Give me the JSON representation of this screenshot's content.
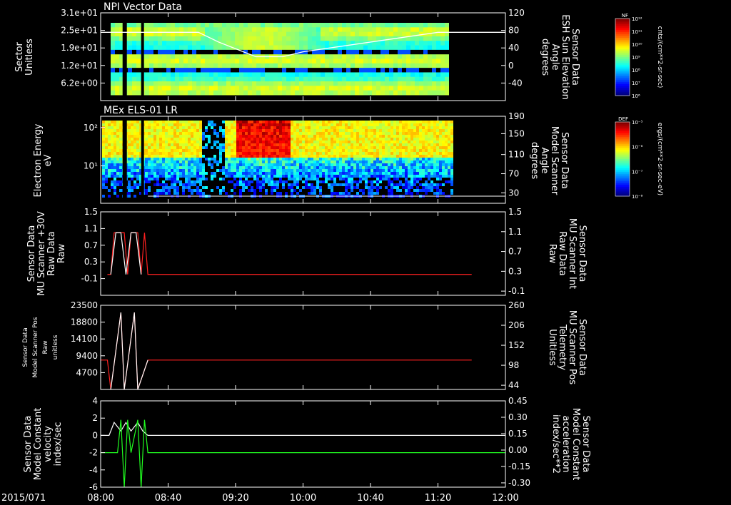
{
  "colors": {
    "background": "#000000",
    "axis": "#ffffff",
    "red": "#ff2020",
    "green": "#20ff20"
  },
  "time_axis": {
    "date": "2015/071",
    "ticks": [
      "08:00",
      "08:40",
      "09:20",
      "10:00",
      "10:40",
      "11:20",
      "12:00"
    ]
  },
  "chart_data": [
    {
      "type": "heatmap",
      "title": "NPI Vector Data",
      "ylabel": "Sector\nUnitless",
      "y_ticks": [
        "3.1e+01",
        "2.5e+01",
        "1.9e+01",
        "1.2e+01",
        "6.2e+00"
      ],
      "y2label": "Sensor Data\nESH Sun Elevation\nAngle\ndegrees",
      "y2_ticks": [
        "120",
        "80",
        "40",
        "0",
        "-40"
      ],
      "colorbar": {
        "label": "NF",
        "units": "cnts/(cm**2-sr-sec)",
        "ticks": [
          "10¹²",
          "10¹¹",
          "10¹⁰",
          "10⁹",
          "10⁸",
          "10⁷",
          "10⁶"
        ]
      },
      "overlay_line": {
        "name": "ESH Sun Elevation Angle",
        "x": [
          "08:00",
          "08:18",
          "08:58",
          "09:10",
          "09:32",
          "09:48",
          "10:00",
          "11:20",
          "12:00"
        ],
        "y": [
          80,
          80,
          80,
          60,
          30,
          30,
          40,
          80,
          80
        ]
      }
    },
    {
      "type": "heatmap",
      "title": "MEx ELS-01 LR",
      "ylabel": "Electron Energy\neV",
      "y_ticks": [
        "10²",
        "10¹"
      ],
      "y2label": "Sensor Data\nModel Scanner\nAngle\ndegrees",
      "y2_ticks": [
        "190",
        "150",
        "110",
        "70",
        "30"
      ],
      "colorbar": {
        "label": "DEF",
        "units": "ergs/(cm**2-sr-sec-eV)",
        "ticks": [
          "10⁻⁵",
          "10⁻⁶",
          "10⁻⁷",
          "10⁻⁸"
        ]
      }
    },
    {
      "type": "line",
      "ylabel": "Sensor Data\nMU Scanner +30V\nRaw Data\nRaw",
      "y_ticks": [
        "1.5",
        "1.1",
        "0.7",
        "0.3",
        "-0.1"
      ],
      "ylim": [
        -0.5,
        1.5
      ],
      "y2label": "Sensor Data\nMU Scanner Int\nRaw Data\nRaw",
      "y2_ticks": [
        "1.5",
        "1.1",
        "0.7",
        "0.3",
        "-0.1"
      ],
      "series": [
        {
          "color": "#ff2020",
          "x": [
            "08:04",
            "08:06",
            "08:08",
            "08:14",
            "08:16",
            "08:18",
            "08:22",
            "08:24",
            "08:26",
            "08:28",
            "11:40"
          ],
          "y": [
            0,
            0,
            1,
            1,
            0,
            1,
            1,
            0,
            1,
            0,
            0
          ]
        },
        {
          "color": "#ffffff",
          "x": [
            "08:06",
            "08:09",
            "08:12",
            "08:15",
            "08:18",
            "08:21",
            "08:24"
          ],
          "y": [
            0,
            1,
            1,
            0,
            1,
            1,
            0
          ]
        }
      ]
    },
    {
      "type": "line",
      "ylabel": "Sensor Data\nModel Scanner Pos\nRaw\nunitless",
      "y_ticks": [
        "23500",
        "18800",
        "14100",
        "9400",
        "4700"
      ],
      "ylim": [
        0,
        23500
      ],
      "y2label": "Sensor Data\nMU Scanner Pos\nTelemetry\nUnitless",
      "y2_ticks": [
        "260",
        "206",
        "152",
        "98",
        "44"
      ],
      "series": [
        {
          "color": "#ff2020",
          "x": [
            "08:00",
            "08:04",
            "08:06",
            "08:12",
            "08:14",
            "08:20",
            "08:22",
            "08:28",
            "11:40"
          ],
          "y": [
            8200,
            8200,
            0,
            21500,
            0,
            21500,
            0,
            8200,
            8200
          ]
        },
        {
          "color": "#ffffff",
          "x": [
            "08:06",
            "08:12",
            "08:14",
            "08:20",
            "08:22",
            "08:28"
          ],
          "y": [
            0,
            21500,
            0,
            21500,
            0,
            8200
          ]
        }
      ]
    },
    {
      "type": "line",
      "ylabel": "Sensor Data\nModel Constant\nvelocity\nindex/sec",
      "y_ticks": [
        "4",
        "2",
        "0",
        "-2",
        "-4",
        "-6"
      ],
      "ylim": [
        -6,
        4
      ],
      "y2label": "Sensor Data\nModel Constant\nacceleration\nindex/sec**2",
      "y2_ticks": [
        "0.45",
        "0.30",
        "0.15",
        "0.00",
        "-0.15",
        "-0.30"
      ],
      "series": [
        {
          "color": "#ffffff",
          "x": [
            "08:00",
            "08:05",
            "08:08",
            "08:12",
            "08:15",
            "08:18",
            "08:22",
            "08:25",
            "08:28",
            "12:00"
          ],
          "y": [
            0,
            0,
            1.5,
            0.5,
            1.5,
            0.5,
            1.5,
            0.5,
            0,
            0
          ]
        },
        {
          "color": "#20ff20",
          "x": [
            "08:00",
            "08:10",
            "08:12",
            "08:14",
            "08:16",
            "08:18",
            "08:22",
            "08:24",
            "08:26",
            "08:28",
            "12:00"
          ],
          "y": [
            -2,
            -2,
            1.8,
            -6,
            1.8,
            -2,
            1.8,
            -6,
            1.8,
            -2,
            -2
          ]
        }
      ]
    }
  ]
}
